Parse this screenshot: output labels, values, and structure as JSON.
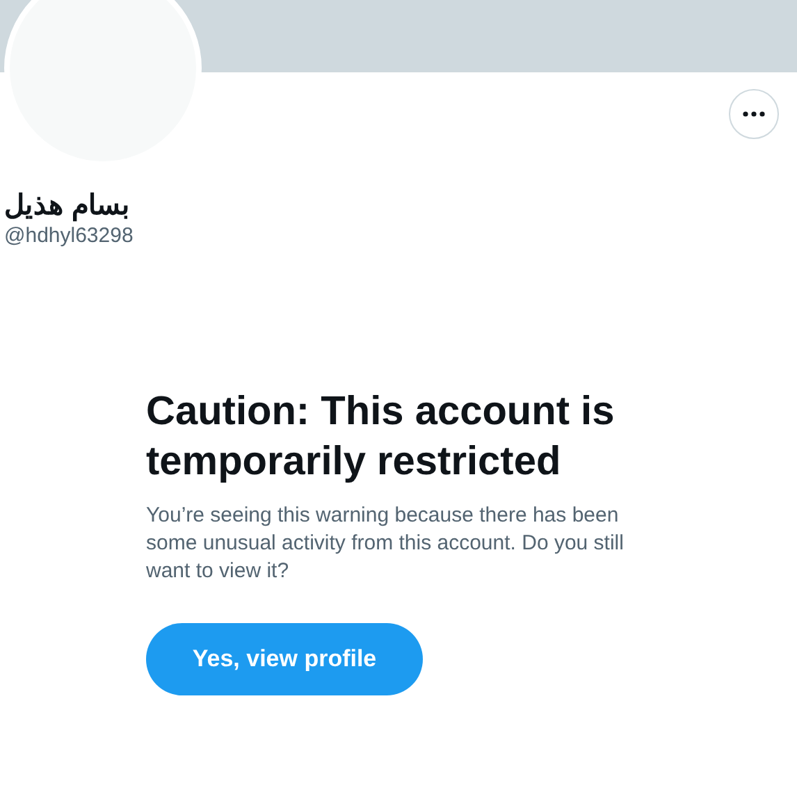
{
  "profile": {
    "name": "بسام هذيل",
    "handle": "@hdhyl63298"
  },
  "warning": {
    "title": "Caution: This account is temporarily restricted",
    "message": "You’re seeing this warning because there has been some unusual activity from this account. Do you still want to view it?",
    "button": "Yes, view profile"
  }
}
